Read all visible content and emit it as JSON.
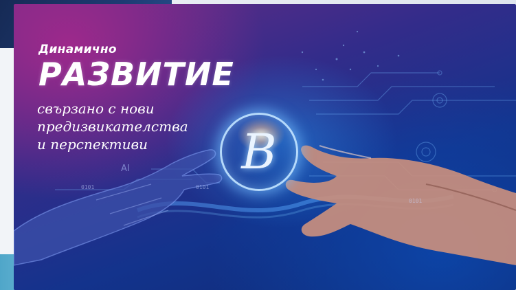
{
  "banner": {
    "line_small": "Динамично",
    "line_big": "РАЗВИТИЕ",
    "subtitle_1": "свързано с нови",
    "subtitle_2": "предизвикателства",
    "subtitle_3": "и перспективи",
    "logo_letter": "B",
    "tech_label_ai": "AI",
    "binary_1": "0101",
    "binary_2": "0101",
    "binary_3": "0101"
  },
  "colors": {
    "magenta": "#6a2d86",
    "deep_blue": "#0e2a74",
    "glow": "#78beff"
  },
  "icons": [
    "robot-hand-icon",
    "human-hand-icon",
    "circuit-lines-icon",
    "logo-b-icon"
  ]
}
